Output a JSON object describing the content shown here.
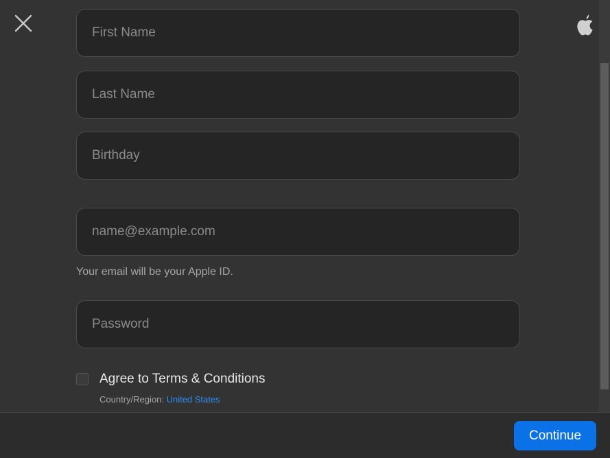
{
  "form": {
    "first_name": {
      "placeholder": "First Name",
      "value": ""
    },
    "last_name": {
      "placeholder": "Last Name",
      "value": ""
    },
    "birthday": {
      "placeholder": "Birthday",
      "value": ""
    },
    "email": {
      "placeholder": "name@example.com",
      "value": ""
    },
    "email_helper": "Your email will be your Apple ID.",
    "password": {
      "placeholder": "Password",
      "value": ""
    },
    "terms_label": "Agree to Terms & Conditions",
    "terms_checked": false,
    "region_prefix": "Country/Region:",
    "region_value": "United States"
  },
  "footer": {
    "continue_label": "Continue"
  },
  "icons": {
    "close": "close-icon",
    "apple": "apple-logo-icon"
  },
  "colors": {
    "background": "#333333",
    "field_background": "#252525",
    "accent": "#0a71e6",
    "link": "#2f8cf2"
  }
}
